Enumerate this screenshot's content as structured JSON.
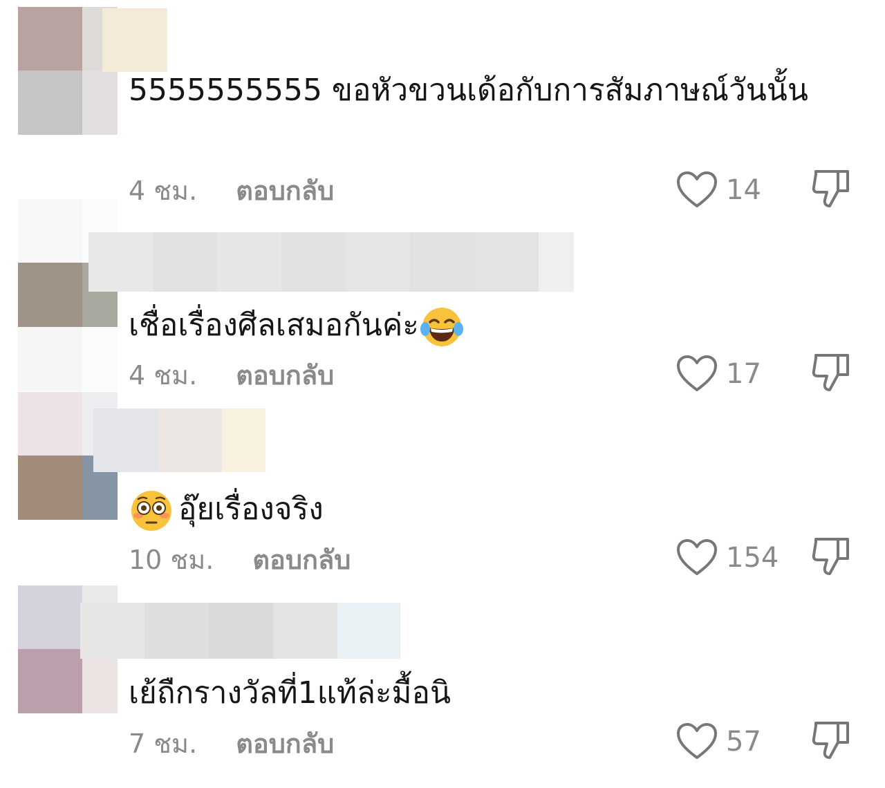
{
  "comments": [
    {
      "text": "5555555555 ขอหัวขวนเด้อกับการสัมภาษณ์วันนั้น",
      "time": "4 ชม.",
      "reply_label": "ตอบกลับ",
      "likes": "14"
    },
    {
      "text": "เชื่อเรื่องศีลเสมอกันค่ะ",
      "emoji": "face-with-tears-of-joy",
      "time": "4 ชม.",
      "reply_label": "ตอบกลับ",
      "likes": "17"
    },
    {
      "emoji": "flushed-face",
      "text": "อุ๊ยเรื่องจริง",
      "time": "10 ชม.",
      "reply_label": "ตอบกลับ",
      "likes": "154"
    },
    {
      "text": "เย้ถืกรางวัลที่1แท้ล่ะมื้อนิ",
      "time": "7 ชม.",
      "reply_label": "ตอบกลับ",
      "likes": "57"
    }
  ],
  "icons": {
    "like": "heart-outline-icon",
    "dislike": "thumbs-down-outline-icon"
  },
  "colors": {
    "text": "#161616",
    "muted": "#8a8a8a",
    "background": "#ffffff"
  }
}
